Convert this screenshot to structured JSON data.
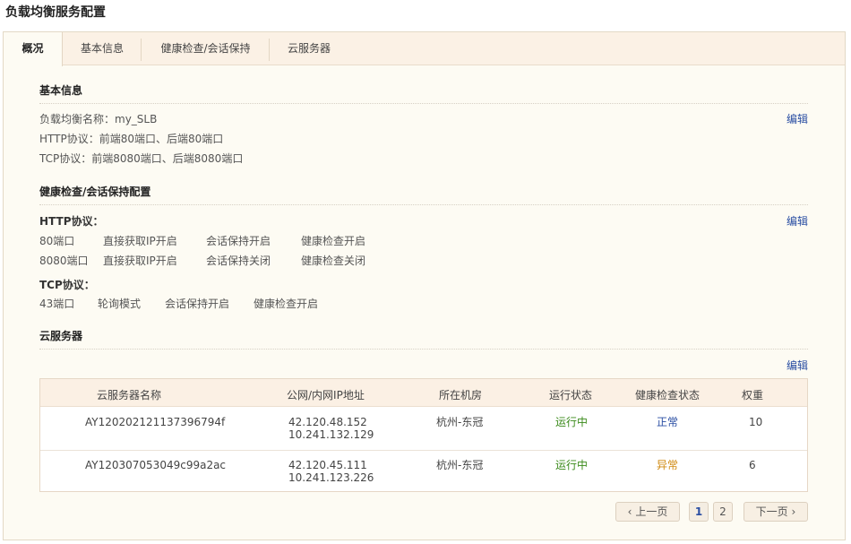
{
  "page_title": "负载均衡服务配置",
  "tabs": [
    {
      "label": "概况"
    },
    {
      "label": "基本信息"
    },
    {
      "label": "健康检查/会话保持"
    },
    {
      "label": "云服务器"
    }
  ],
  "basic": {
    "title": "基本信息",
    "name_line": "负载均衡名称：my_SLB",
    "http_line": "HTTP协议：前端80端口、后端80端口",
    "tcp_line": "TCP协议：前端8080端口、后端8080端口",
    "edit_label": "编辑"
  },
  "health": {
    "title": "健康检查/会话保持配置",
    "http_label": "HTTP协议：",
    "edit_label": "编辑",
    "http_rows": [
      [
        "80端口",
        "直接获取IP开启",
        "会话保持开启",
        "健康检查开启"
      ],
      [
        "8080端口",
        "直接获取IP开启",
        "会话保持关闭",
        "健康检查关闭"
      ]
    ],
    "tcp_label": "TCP协议：",
    "tcp_row": [
      "43端口",
      "轮询模式",
      "会话保持开启",
      "健康检查开启"
    ]
  },
  "servers": {
    "title": "云服务器",
    "edit_label": "编辑",
    "columns": [
      "云服务器名称",
      "公网/内网IP地址",
      "所在机房",
      "运行状态",
      "健康检查状态",
      "权重"
    ],
    "rows": [
      {
        "name": "AY120202121137396794f",
        "ip_public": "42.120.48.152",
        "ip_private": "10.241.132.129",
        "zone": "杭州-东冠",
        "status": "运行中",
        "health": "正常",
        "weight": "10"
      },
      {
        "name": "AY120307053049c99a2ac",
        "ip_public": "42.120.45.111",
        "ip_private": "10.241.123.226",
        "zone": "杭州-东冠",
        "status": "运行中",
        "health": "异常",
        "weight": "6"
      }
    ]
  },
  "pagination": {
    "prev": "上一页",
    "next": "下一页",
    "pages": [
      "1",
      "2"
    ],
    "current": "1"
  },
  "colors": {
    "status_running": "#3a8a1a",
    "health_normal": "#2a4ea3",
    "health_abnormal": "#d08a12",
    "link": "#2a4ea3"
  }
}
